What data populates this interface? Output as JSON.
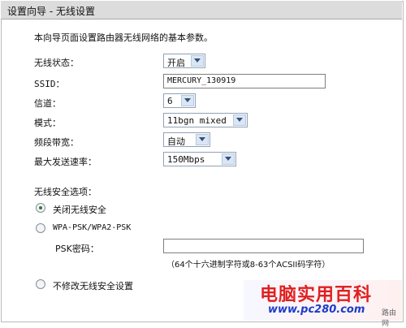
{
  "title": "设置向导 - 无线设置",
  "intro": "本向导页面设置路由器无线网络的基本参数。",
  "fields": {
    "wireless_status": {
      "label": "无线状态：",
      "value": "开启"
    },
    "ssid": {
      "label": "SSID：",
      "value": "MERCURY_130919"
    },
    "channel": {
      "label": "信道：",
      "value": "6"
    },
    "mode": {
      "label": "模式：",
      "value": "11bgn mixed"
    },
    "bandwidth": {
      "label": "频段带宽：",
      "value": "自动"
    },
    "max_rate": {
      "label": "最大发送速率：",
      "value": "150Mbps"
    }
  },
  "security": {
    "heading": "无线安全选项：",
    "options": [
      {
        "label": "关闭无线安全",
        "checked": true
      },
      {
        "label": "WPA-PSK/WPA2-PSK",
        "checked": false
      },
      {
        "label": "不修改无线安全设置",
        "checked": false
      }
    ],
    "psk_label": "PSK密码：",
    "psk_value": "",
    "psk_hint": "（64个十六进制字符或8-63个ACSII码字符）"
  },
  "watermark": {
    "main": "电脑实用百科",
    "url": "www.pc280.com",
    "side": "路由网"
  }
}
